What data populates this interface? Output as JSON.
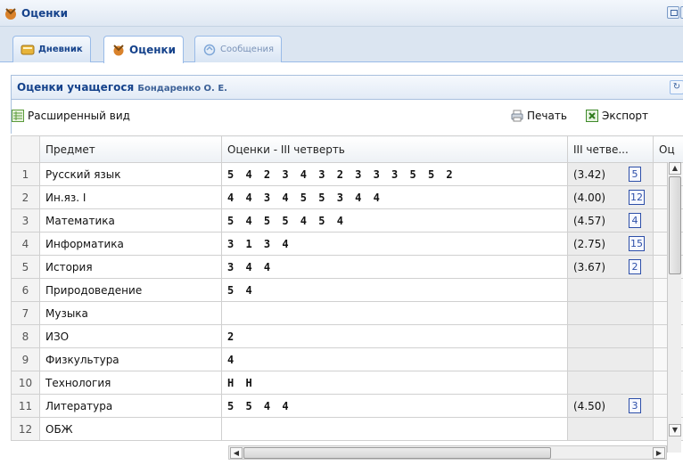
{
  "window": {
    "title": "Оценки",
    "icon": "grades-flag-icon"
  },
  "tabs": [
    {
      "label": "Дневник",
      "icon": "diary-book-icon"
    },
    {
      "label": "Оценки",
      "icon": "grades-flag-icon"
    },
    {
      "label": "Сообщения",
      "icon": "messages-icon"
    }
  ],
  "panel": {
    "title": "Оценки учащегося",
    "student": "Бондаренко О. Е."
  },
  "toolbar": {
    "extended_view": "Расширенный вид",
    "print": "Печать",
    "export": "Экспорт"
  },
  "grid": {
    "columns": [
      "",
      "Предмет",
      "Оценки - III четверть",
      "III четве...",
      "Оц"
    ],
    "rows": [
      {
        "n": "1",
        "subject": "Русский язык",
        "grades": "5 4 2 3 4 3 2 3 3 3 5 5 2",
        "avg": "(3.42)",
        "count": "5"
      },
      {
        "n": "2",
        "subject": "Ин.яз. I",
        "grades": "4 4 3 4 5 5 3 4 4",
        "avg": "(4.00)",
        "count": "12"
      },
      {
        "n": "3",
        "subject": "Математика",
        "grades": "5 4 5 5 4 5 4",
        "avg": "(4.57)",
        "count": "4"
      },
      {
        "n": "4",
        "subject": "Информатика",
        "grades": "3 1 3 4",
        "avg": "(2.75)",
        "count": "15"
      },
      {
        "n": "5",
        "subject": "История",
        "grades": "3 4 4",
        "avg": "(3.67)",
        "count": "2"
      },
      {
        "n": "6",
        "subject": "Природоведение",
        "grades": "5 4",
        "avg": "",
        "count": ""
      },
      {
        "n": "7",
        "subject": "Музыка",
        "grades": "",
        "avg": "",
        "count": ""
      },
      {
        "n": "8",
        "subject": "ИЗО",
        "grades": "2",
        "avg": "",
        "count": ""
      },
      {
        "n": "9",
        "subject": "Физкультура",
        "grades": "4",
        "avg": "",
        "count": ""
      },
      {
        "n": "10",
        "subject": "Технология",
        "grades": "Н Н",
        "avg": "",
        "count": ""
      },
      {
        "n": "11",
        "subject": "Литература",
        "grades": "5 5 4 4",
        "avg": "(4.50)",
        "count": "3"
      },
      {
        "n": "12",
        "subject": "ОБЖ",
        "grades": "",
        "avg": "",
        "count": ""
      }
    ]
  },
  "colors": {
    "header_blue": "#15428b",
    "count_border": "#2d4fa8"
  }
}
